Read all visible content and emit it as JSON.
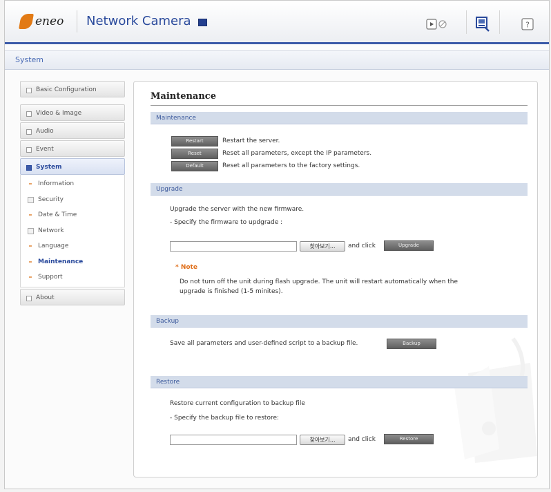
{
  "header": {
    "logo_text": "eneo",
    "title": "Network Camera",
    "icons": [
      "live-view-icon",
      "setup-icon",
      "help-icon"
    ]
  },
  "breadcrumb": {
    "label": "System"
  },
  "sidebar": {
    "items": [
      {
        "label": "Basic Configuration"
      },
      {
        "label": "Video & Image"
      },
      {
        "label": "Audio"
      },
      {
        "label": "Event"
      },
      {
        "label": "System"
      },
      {
        "label": "About"
      }
    ],
    "system_sub": [
      {
        "label": "Information"
      },
      {
        "label": "Security"
      },
      {
        "label": "Date & Time"
      },
      {
        "label": "Network"
      },
      {
        "label": "Language"
      },
      {
        "label": "Maintenance"
      },
      {
        "label": "Support"
      }
    ]
  },
  "main": {
    "title": "Maintenance",
    "maintenance": {
      "section_label": "Maintenance",
      "restart_label": "Restart",
      "restart_desc": "Restart the server.",
      "reset_label": "Reset",
      "reset_desc": "Reset all parameters, except the IP parameters.",
      "default_label": "Default",
      "default_desc": "Reset all parameters to the factory settings."
    },
    "upgrade": {
      "section_label": "Upgrade",
      "line1": "Upgrade the server with the new firmware.",
      "line2": "- Specify the firmware to updgrade :",
      "browse_label": "찾아보기...",
      "and_click": "and click",
      "upgrade_label": "Upgrade",
      "note_title": "* Note",
      "note_line1": "Do not turn off the unit during flash upgrade. The unit will restart automatically when the",
      "note_line2": "upgrade is finished (1-5 minites)."
    },
    "backup": {
      "section_label": "Backup",
      "text": "Save all parameters and user-defined script to a backup file.",
      "backup_label": "Backup"
    },
    "restore": {
      "section_label": "Restore",
      "line1": "Restore current configuration to backup file",
      "line2": "- Specify the backup file to restore:",
      "browse_label": "찾아보기...",
      "and_click": "and click",
      "restore_label": "Restore"
    }
  },
  "colors": {
    "accent": "#3b5aa8",
    "section_bar": "#d3dcea",
    "note": "#e0701c"
  }
}
